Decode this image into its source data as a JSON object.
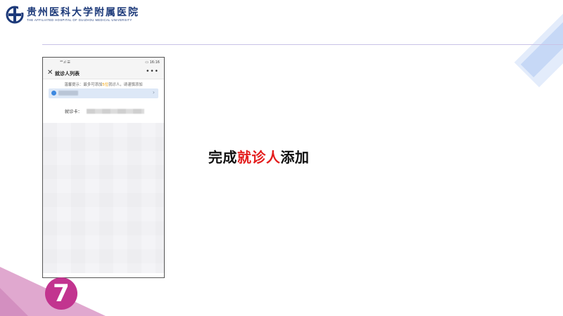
{
  "header": {
    "logo_cn": "贵州医科大学附属医院",
    "logo_en": "THE AFFILIATED HOSPITAL OF GUIZHOU MEDICAL UNIVERSITY"
  },
  "phone": {
    "status_left": "⁴ᴳ.ıl ☰",
    "status_right": "▭ 16:16",
    "nav": {
      "close": "✕",
      "title": "就诊人列表",
      "more": "•••"
    },
    "tip_before": "温馨提示：最多可添加",
    "tip_highlight": "5位",
    "tip_after": "就诊人，请谨慎添加",
    "patient_arrow": "›",
    "card_label": "就诊卡："
  },
  "caption": {
    "part1": "完成",
    "part2": "就诊人",
    "part3": "添加"
  },
  "step": {
    "number": "7"
  },
  "colors": {
    "accent_red": "#e41e1e",
    "badge": "#c2348f",
    "brand_blue": "#1d3a7a"
  }
}
